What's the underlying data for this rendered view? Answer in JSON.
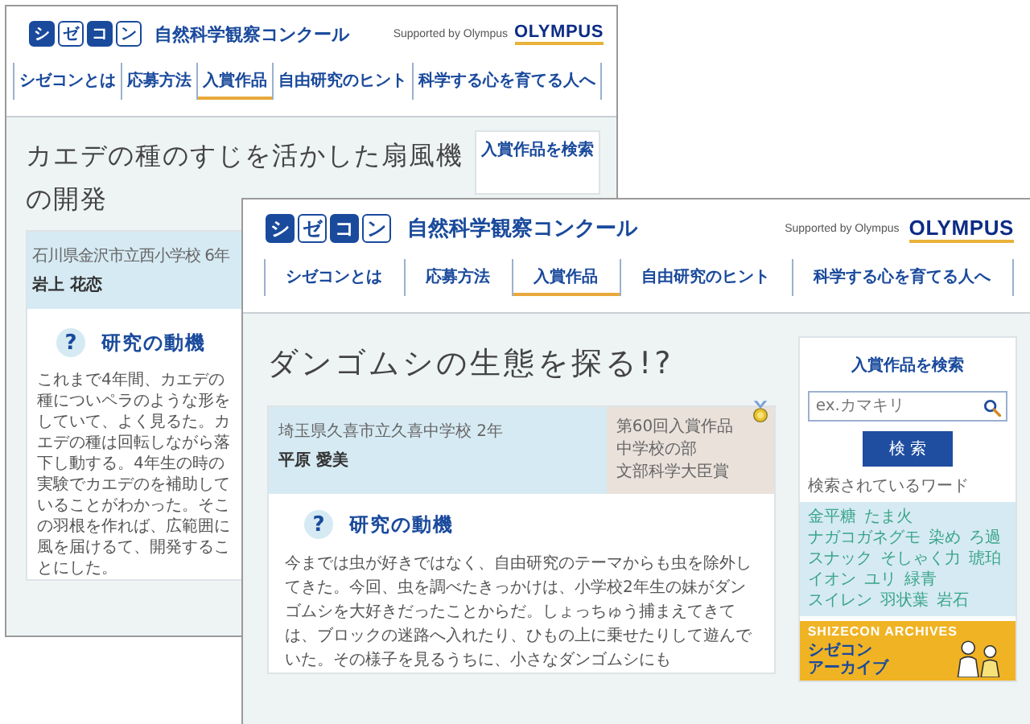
{
  "windows": [
    {
      "kind": "back",
      "header": {
        "logo": [
          "シ",
          "ゼ",
          "コ",
          "ン"
        ],
        "title": "自然科学観察コンクール",
        "supported": "Supported by Olympus",
        "sponsor": "OLYMPUS"
      },
      "nav": [
        {
          "label": "シゼコンとは",
          "selected": false
        },
        {
          "label": "応募方法",
          "selected": false
        },
        {
          "label": "入賞作品",
          "selected": true
        },
        {
          "label": "自由研究のヒント",
          "selected": false
        },
        {
          "label": "科学する心を育てる人へ",
          "selected": false
        }
      ],
      "article": {
        "title": "カエデの種のすじを活かした扇風機の開発",
        "school": "石川県金沢市立西小学校 6年",
        "author": "岩上 花恋",
        "heading_icon": "?",
        "heading": "研究の動機",
        "paragraph": "これまで4年間、カエデの種についペラのような形をしていて、よく見るた。カエデの種は回転しながら落下し動する。4年生の時の実験でカエデのを補助していることがわかった。そこの羽根を作れば、広範囲に風を届けるて、開発することにした。"
      },
      "sidebar": {
        "title": "入賞作品を検索"
      }
    },
    {
      "kind": "front",
      "header": {
        "logo": [
          "シ",
          "ゼ",
          "コ",
          "ン"
        ],
        "title": "自然科学観察コンクール",
        "supported": "Supported by Olympus",
        "sponsor": "OLYMPUS"
      },
      "nav": [
        {
          "label": "シゼコンとは",
          "selected": false
        },
        {
          "label": "応募方法",
          "selected": false
        },
        {
          "label": "入賞作品",
          "selected": true
        },
        {
          "label": "自由研究のヒント",
          "selected": false
        },
        {
          "label": "科学する心を育てる人へ",
          "selected": false
        }
      ],
      "article": {
        "title": "ダンゴムシの生態を探る!?",
        "school": "埼玉県久喜市立久喜中学校 2年",
        "author": "平原 愛美",
        "award": [
          "第60回入賞作品",
          "中学校の部",
          "文部科学大臣賞"
        ],
        "heading_icon": "?",
        "heading": "研究の動機",
        "paragraph": "今までは虫が好きではなく、自由研究のテーマからも虫を除外してきた。今回、虫を調べたきっかけは、小学校2年生の妹がダンゴムシを大好きだったことからだ。しょっちゅう捕まえてきては、ブロックの迷路へ入れたり、ひもの上に乗せたりして遊んでいた。その様子を見るうちに、小さなダンゴムシにも"
      },
      "sidebar": {
        "title": "入賞作品を検索",
        "search_placeholder": "ex.カマキリ",
        "search_button": "検 索",
        "words_label": "検索されているワード",
        "words": [
          "金平糖",
          "たま火",
          "ナガコガネグモ",
          "染め",
          "ろ過",
          "スナック",
          "そしゃく力",
          "琥珀",
          "イオン",
          "ユリ",
          "緑青",
          "スイレン",
          "羽状葉",
          "岩石"
        ],
        "archive": {
          "label": "SHIZECON ARCHIVES",
          "title": "シゼコン",
          "subtitle": "アーカイブ"
        }
      }
    }
  ]
}
